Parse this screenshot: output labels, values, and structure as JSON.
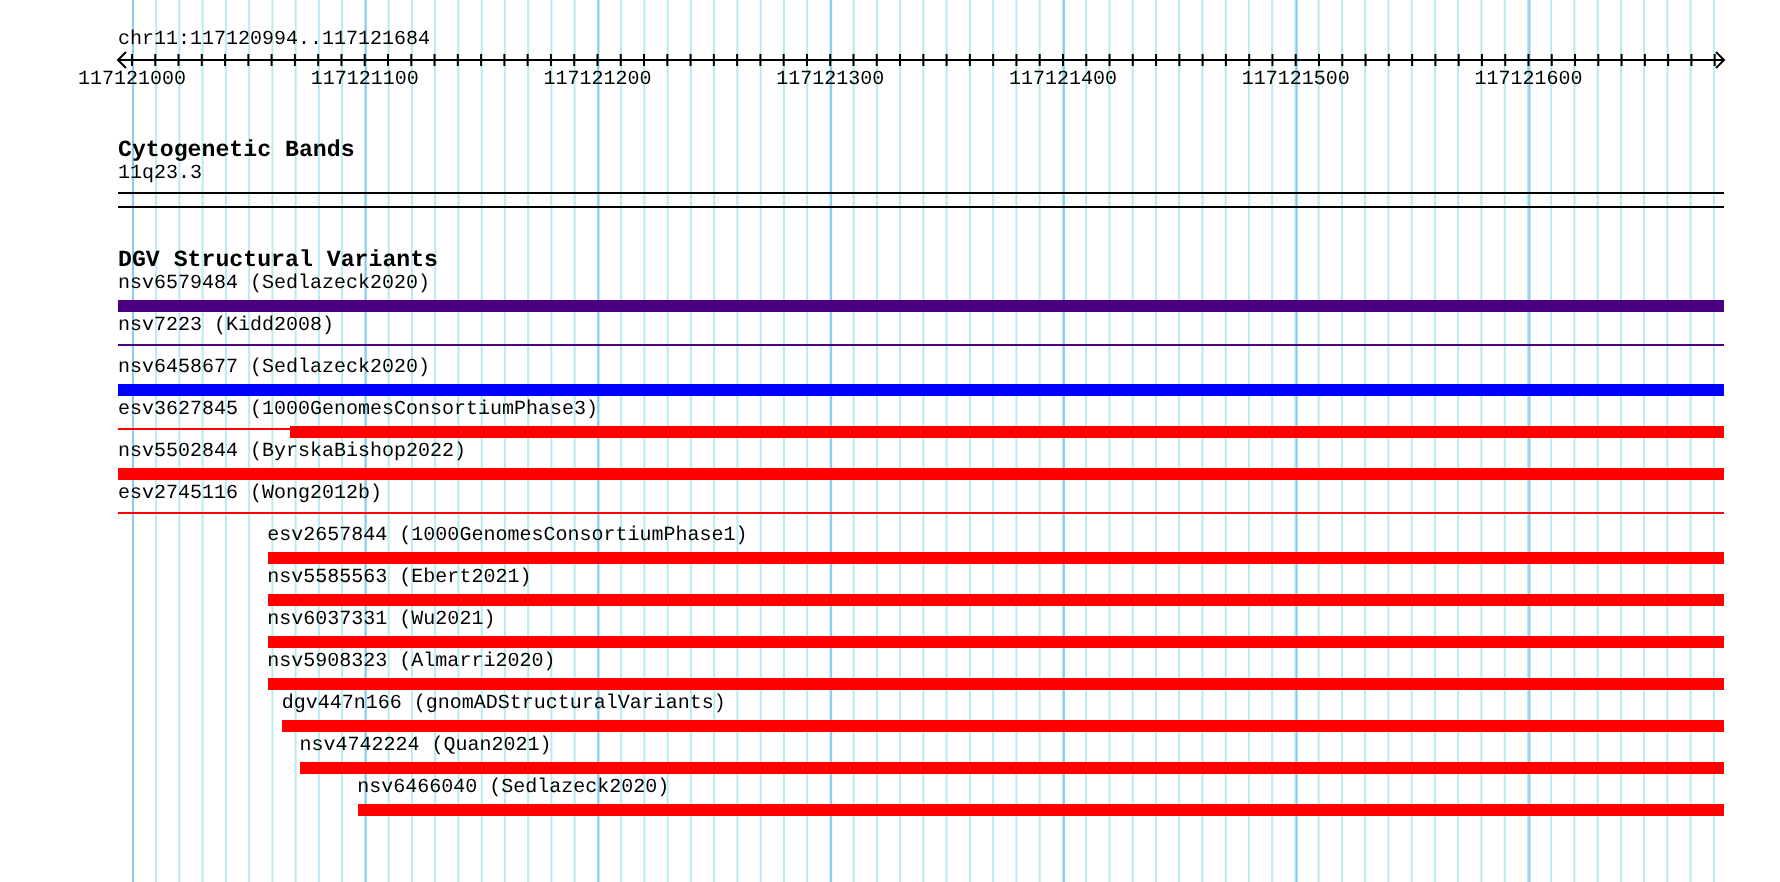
{
  "ruler": {
    "range": "chr11:117120994..117121684",
    "ticks": [
      "117121000",
      "117121100",
      "117121200",
      "117121300",
      "117121400",
      "117121500",
      "117121600"
    ]
  },
  "cytogenetic_bands": {
    "title": "Cytogenetic Bands",
    "band": "11q23.3"
  },
  "structural_variants": {
    "title": "DGV Structural Variants",
    "features": [
      {
        "label": "nsv6579484 (Sedlazeck2020)",
        "kind": "bar",
        "color": "#4b0082",
        "level": 1
      },
      {
        "label": "nsv7223 (Kidd2008)",
        "kind": "line",
        "color": "#4b0082"
      },
      {
        "label": "nsv6458677 (Sedlazeck2020)",
        "kind": "bar",
        "color": "#0000ff",
        "level": 1
      },
      {
        "label": "esv3627845 (1000GenomesConsortiumPhase3)",
        "kind": "line-bar",
        "color": "#ff0000",
        "level": 0.893
      },
      {
        "label": "nsv5502844 (ByrskaBishop2022)",
        "kind": "bar",
        "color": "#ff0000",
        "level": 1
      },
      {
        "label": "esv2745116 (Wong2012b)",
        "kind": "line",
        "color": "#ff0000"
      },
      {
        "label": "esv2657844 (1000GenomesConsortiumPhase1)",
        "kind": "bar",
        "color": "#ff0000",
        "level": 0.907
      },
      {
        "label": "nsv5585563 (Ebert2021)",
        "kind": "bar",
        "color": "#ff0000",
        "level": 0.907
      },
      {
        "label": "nsv6037331 (Wu2021)",
        "kind": "bar",
        "color": "#ff0000",
        "level": 0.907
      },
      {
        "label": "nsv5908323 (Almarri2020)",
        "kind": "bar",
        "color": "#ff0000",
        "level": 0.907
      },
      {
        "label": "dgv447n166 (gnomADStructuralVariants)",
        "kind": "bar",
        "color": "#ff0000",
        "level": 0.898
      },
      {
        "label": "nsv4742224 (Quan2021)",
        "kind": "bar",
        "color": "#ff0000",
        "level": 0.887
      },
      {
        "label": "nsv6466040 (Sedlazeck2020)",
        "kind": "bar",
        "color": "#ff0000",
        "level": 0.851
      }
    ]
  }
}
